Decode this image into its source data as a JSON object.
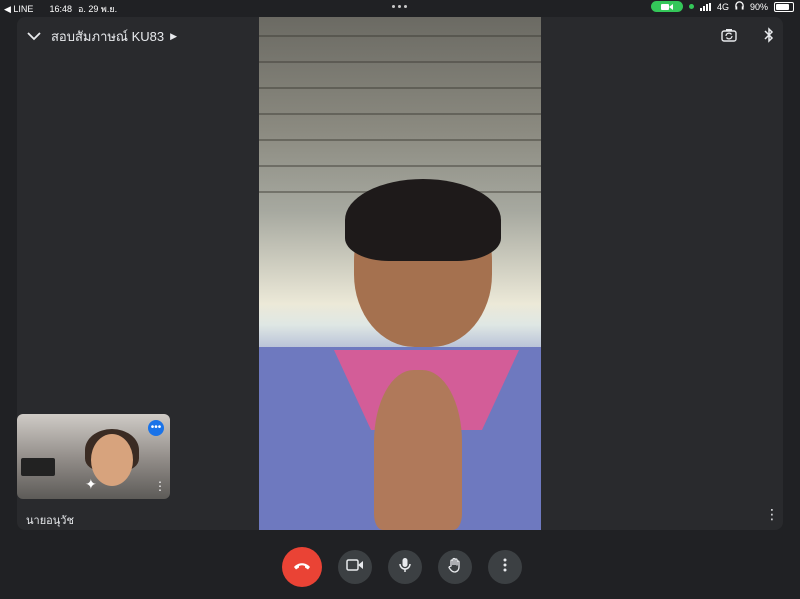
{
  "status_bar": {
    "back_app": "◀ LINE",
    "time": "16:48",
    "date": "อ. 29 พ.ย.",
    "network": "4G",
    "battery": "90%"
  },
  "meeting": {
    "title": "สอบสัมภาษณ์ KU83"
  },
  "self_tile": {
    "name": "นายอนุวัช"
  },
  "icons": {
    "collapse": "chevron-down-icon",
    "title_menu": "caret-right-icon",
    "camera_switch": "camera-switch-icon",
    "bluetooth": "bluetooth-icon",
    "end_call": "phone-hangup-icon",
    "camera": "video-camera-icon",
    "mic": "microphone-icon",
    "raise_hand": "hand-icon",
    "more": "more-vertical-icon"
  },
  "colors": {
    "background": "#202124",
    "stage": "#292a2d",
    "end_call": "#ea4335",
    "control_button": "#3c4043",
    "tile_menu": "#1a73e8",
    "status_green": "#34c759"
  }
}
